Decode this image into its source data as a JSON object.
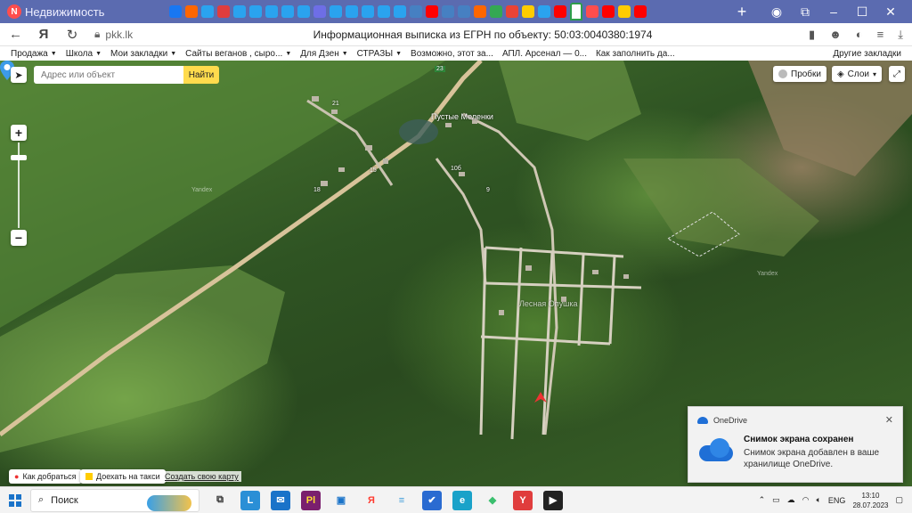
{
  "browser": {
    "site_tab_title": "Недвижимость",
    "nav": {
      "back_icon": "back-arrow-icon",
      "refresh_icon": "refresh-icon"
    },
    "url": "pkk.lk",
    "page_title": "Информационная выписка из ЕГРН по объекту: 50:03:0040380:1974",
    "tab_colors": [
      "#1877f2",
      "#ff6600",
      "#2aa3ef",
      "#e03d3d",
      "#2aa3ef",
      "#2aa3ef",
      "#2aa3ef",
      "#2aa3ef",
      "#2aa3ef",
      "#6e6ee6",
      "#2aa3ef",
      "#2aa3ef",
      "#2aa3ef",
      "#2aa3ef",
      "#2aa3ef",
      "#4680c2",
      "#ff0000",
      "#4680c2",
      "#4680c2",
      "#ff6600",
      "#34a853",
      "#ea4335",
      "#ffcc00",
      "#2aa3ef",
      "#ff0000",
      "#ff4d4d",
      "#ff0000",
      "#ffcc00",
      "#ff0000"
    ]
  },
  "bookmarks": [
    {
      "label": "Продажа",
      "caret": true
    },
    {
      "label": "Школа",
      "caret": true
    },
    {
      "label": "Мои закладки",
      "caret": true
    },
    {
      "label": "Сайты веганов , сыро...",
      "caret": true
    },
    {
      "label": "Для Дзен",
      "caret": true
    },
    {
      "label": "СТРАЗЫ",
      "caret": true
    },
    {
      "label": "Возможно, этот за...",
      "caret": false
    },
    {
      "label": "АПЛ. Арсенал — 0...",
      "caret": false
    },
    {
      "label": "Как заполнить да...",
      "caret": false
    }
  ],
  "bookmarks_other": "Другие закладки",
  "map": {
    "search_placeholder": "Адрес или объект",
    "search_button": "Найти",
    "traffic_label": "Пробки",
    "layers_label": "Слои",
    "route_label": "Как добраться",
    "taxi_label": "Доехать на такси",
    "create_map_label": "Создать свою карту",
    "village_label": "Пустые Меленки",
    "snt_label": "Лесная Опушка",
    "road_badge": "23",
    "yandex_watermark": "Yandex",
    "house_numbers": [
      "21",
      "15",
      "18",
      "10б",
      "9"
    ]
  },
  "toast": {
    "app_name": "OneDrive",
    "title": "Снимок экрана сохранен",
    "text": "Снимок экрана добавлен в ваше хранилище OneDrive."
  },
  "taskbar": {
    "search_label": "Поиск",
    "language": "ENG",
    "time": "13:10",
    "date": "28.07.2023",
    "apps": [
      {
        "name": "task-view-icon",
        "glyph": "⧉",
        "color": "#333",
        "bg": "transparent"
      },
      {
        "name": "app-l-icon",
        "glyph": "L",
        "color": "#fff",
        "bg": "#2a8fd6"
      },
      {
        "name": "mail-icon",
        "glyph": "✉",
        "color": "#fff",
        "bg": "#1a73c9"
      },
      {
        "name": "app-pl-icon",
        "glyph": "Pl",
        "color": "#ffdd33",
        "bg": "#7a1f6e"
      },
      {
        "name": "store-icon",
        "glyph": "▣",
        "color": "#1a73c9",
        "bg": "transparent"
      },
      {
        "name": "yandex-browser-icon",
        "glyph": "Я",
        "color": "#ff3b30",
        "bg": "transparent"
      },
      {
        "name": "notepad-icon",
        "glyph": "≡",
        "color": "#3a9ad9",
        "bg": "transparent"
      },
      {
        "name": "app-check-icon",
        "glyph": "✔",
        "color": "#fff",
        "bg": "#2a6bd1"
      },
      {
        "name": "edge-icon",
        "glyph": "e",
        "color": "#fff",
        "bg": "#1aa2c9"
      },
      {
        "name": "app-green-icon",
        "glyph": "◆",
        "color": "#3bbf6e",
        "bg": "transparent"
      },
      {
        "name": "app-yandex-red-icon",
        "glyph": "Y",
        "color": "#fff",
        "bg": "#e03d3d"
      },
      {
        "name": "media-player-icon",
        "glyph": "▶",
        "color": "#fff",
        "bg": "#222"
      }
    ]
  }
}
